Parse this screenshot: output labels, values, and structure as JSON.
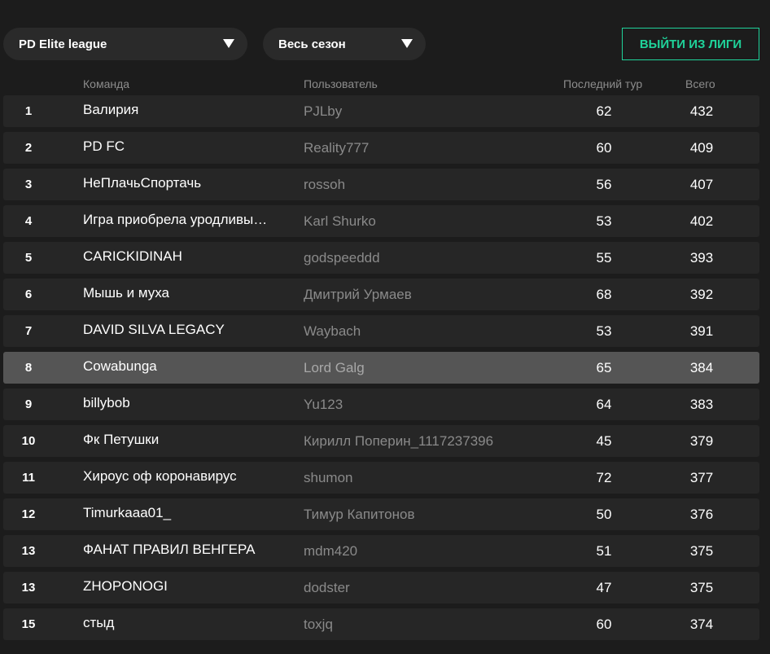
{
  "filters": {
    "league": "PD Elite league",
    "period": "Весь сезон"
  },
  "actions": {
    "exit_league": "ВЫЙТИ ИЗ ЛИГИ"
  },
  "table": {
    "headers": {
      "team": "Команда",
      "user": "Пользователь",
      "last_round": "Последний тур",
      "total": "Всего"
    },
    "rows": [
      {
        "rank": "1",
        "team": "Валирия",
        "user": "PJLby",
        "last": "62",
        "total": "432"
      },
      {
        "rank": "2",
        "team": "PD FC",
        "user": "Reality777",
        "last": "60",
        "total": "409"
      },
      {
        "rank": "3",
        "team": "НеПлачьСпортачь",
        "user": "rossoh",
        "last": "56",
        "total": "407"
      },
      {
        "rank": "4",
        "team": "Игра приобрела уродливый...",
        "user": "Karl Shurko",
        "last": "53",
        "total": "402"
      },
      {
        "rank": "5",
        "team": "CARICKIDINAH",
        "user": "godspeeddd",
        "last": "55",
        "total": "393"
      },
      {
        "rank": "6",
        "team": "Мышь и муха",
        "user": "Дмитрий Урмаев",
        "last": "68",
        "total": "392"
      },
      {
        "rank": "7",
        "team": "DAVID SILVA LEGACY",
        "user": "Waybach",
        "last": "53",
        "total": "391"
      },
      {
        "rank": "8",
        "team": "Cowabunga",
        "user": "Lord Galg",
        "last": "65",
        "total": "384"
      },
      {
        "rank": "9",
        "team": "billybob",
        "user": "Yu123",
        "last": "64",
        "total": "383"
      },
      {
        "rank": "10",
        "team": "Фк Петушки",
        "user": "Кирилл Поперин_1117237396",
        "last": "45",
        "total": "379"
      },
      {
        "rank": "11",
        "team": "Хироус оф коронавирус",
        "user": "shumon",
        "last": "72",
        "total": "377"
      },
      {
        "rank": "12",
        "team": "Timurkaaa01_",
        "user": "Тимур Капитонов",
        "last": "50",
        "total": "376"
      },
      {
        "rank": "13",
        "team": "ФАНАТ ПРАВИЛ ВЕНГЕРА",
        "user": "mdm420",
        "last": "51",
        "total": "375"
      },
      {
        "rank": "13",
        "team": "ZHOPONOGI",
        "user": "dodster",
        "last": "47",
        "total": "375"
      },
      {
        "rank": "15",
        "team": "стыд",
        "user": "toxjq",
        "last": "60",
        "total": "374"
      }
    ]
  }
}
